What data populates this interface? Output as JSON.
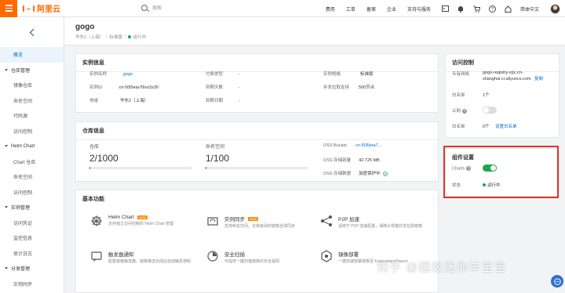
{
  "topbar": {
    "brand": "阿里云",
    "search_placeholder": "搜索",
    "links": [
      "费用",
      "工单",
      "备案",
      "企业",
      "支持与服务"
    ],
    "lang": "简体中文",
    "icons": [
      "terminal-icon",
      "bell-icon",
      "cart-icon",
      "help-icon",
      "home-icon"
    ]
  },
  "sidebar": {
    "back_glyph": "〈",
    "items": [
      {
        "label": "概览",
        "active": true,
        "group": false
      },
      {
        "label": "仓库管理",
        "group": true
      },
      {
        "label": "镜像仓库",
        "group": false
      },
      {
        "label": "命名空间",
        "group": false
      },
      {
        "label": "代码源",
        "group": false
      },
      {
        "label": "访问控制",
        "group": false
      },
      {
        "label": "Helm Chart",
        "group": true
      },
      {
        "label": "Chart 仓库",
        "group": false
      },
      {
        "label": "命名空间",
        "group": false
      },
      {
        "label": "访问控制",
        "group": false
      },
      {
        "label": "实例管理",
        "group": true
      },
      {
        "label": "访问凭证",
        "group": false
      },
      {
        "label": "监控信息",
        "group": false
      },
      {
        "label": "审计日志",
        "group": false
      },
      {
        "label": "分发管理",
        "group": true
      },
      {
        "label": "实例同步",
        "group": false
      }
    ]
  },
  "header": {
    "name": "gogo",
    "region": "华东2（上海）",
    "edition": "标准版",
    "status": "运行中"
  },
  "instance_info": {
    "title": "实例信息",
    "rows": [
      {
        "k": "实例名称",
        "v": "gogo",
        "link": true
      },
      {
        "k": "实例ID",
        "v": "cri-50l5eta7l6vx3z30",
        "link": false
      },
      {
        "k": "地域",
        "v": "华东2（上海）",
        "link": false
      },
      {
        "k": "付费类型",
        "v": "-",
        "link": false
      },
      {
        "k": "到期天数",
        "v": "-",
        "link": false
      },
      {
        "k": "到期日期",
        "v": "-",
        "link": false
      },
      {
        "k": "实例规格",
        "v": "标准版",
        "link": false
      },
      {
        "k": "并发拉取支持",
        "v": "500节点",
        "link": false
      }
    ]
  },
  "repo_info": {
    "title": "仓库信息",
    "repo_label": "仓库",
    "repo_value": "2/1000",
    "repo_ratio": 0.002,
    "ns_label": "命名空间",
    "ns_value": "1/100",
    "ns_ratio": 0.01,
    "oss_rows": [
      {
        "k": "OSS Bucket",
        "v": "cri-50l5eta7...",
        "link": true
      },
      {
        "k": "OSS 存储容量",
        "v": "42.725 MB",
        "link": false
      },
      {
        "k": "OSS 存储数据",
        "v": "加密保护中",
        "link": false
      }
    ]
  },
  "features": {
    "title": "基本功能",
    "new_tag": "NEW",
    "items": [
      {
        "title": "Helm Chart",
        "desc": "支持独立访问控制的 Helm Chart 管理",
        "icon": "helm-icon",
        "is_new": true
      },
      {
        "title": "实例同步",
        "desc": "支持命名空间，仓库级别的镜像全球同步",
        "icon": "sync-icon",
        "is_new": true
      },
      {
        "title": "P2P 加速",
        "desc": "适用于 P2P 加速配置，保障大规模并发拉取镜像",
        "icon": "p2p-icon",
        "is_new": false
      },
      {
        "title": "触发器通知",
        "desc": "配置镜像触发器，镜像推送完成后自动触发通知",
        "icon": "trigger-icon",
        "is_new": false
      },
      {
        "title": "安全扫描",
        "desc": "可提供一键扫描镜像的安全漏洞",
        "icon": "scan-icon",
        "is_new": false
      },
      {
        "title": "镜像部署",
        "desc": "一键快速部署镜像至 Kubernetes/Swarm",
        "icon": "deploy-icon",
        "is_new": false
      }
    ]
  },
  "access": {
    "title": "访问控制",
    "vpc_label": "专有网络",
    "vpc_value": "gogo-registry-vpc.cn-shanghai.cr.aliyuncs.com",
    "copy": "复制",
    "whitelist_label": "白名单",
    "whitelist_value": "1个",
    "public_label": "公网",
    "whitelist2_label": "白名单",
    "whitelist2_value": "0个",
    "whitelist2_link": "设置白名单"
  },
  "components": {
    "title": "组件设置",
    "charts_label": "Charts",
    "status_label": "状态",
    "status_value": "运行中"
  },
  "watermark": "知乎 @超级迷你羊宝宝",
  "colors": {
    "accent": "#ff6a00",
    "link": "#0070cc",
    "success": "#1ea64a",
    "highlight": "#d9362b"
  }
}
